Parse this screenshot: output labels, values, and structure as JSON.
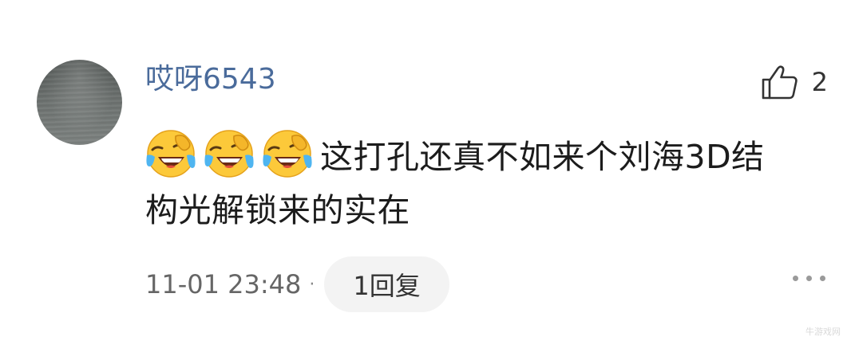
{
  "comment": {
    "username": "哎呀6543",
    "likes": "2",
    "content_line1": "这打孔还真不如来个刘海3D结",
    "content_line2": "构光解锁来的实在",
    "emojis": [
      "crying-laughing-emoji",
      "crying-laughing-emoji",
      "crying-laughing-emoji"
    ],
    "timestamp": "11-01 23:48",
    "separator": "·",
    "reply_label": "1回复",
    "more_icon": "more-dots-icon",
    "like_icon": "thumbs-up-icon"
  },
  "colors": {
    "username": "#4a6b9b",
    "text": "#1c1c1c",
    "meta": "#666666",
    "pill_bg": "#f3f3f3"
  },
  "watermark": "牛游戏网"
}
